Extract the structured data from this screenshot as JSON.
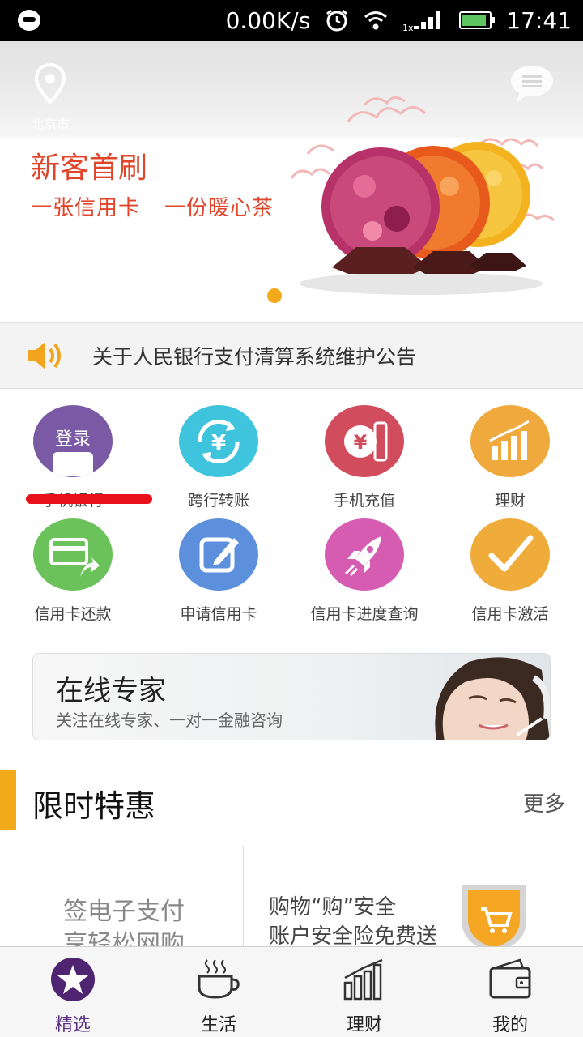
{
  "status_bar": {
    "network_speed": "0.00K/s",
    "time": "17:41",
    "signal_prefix": "1x"
  },
  "banner": {
    "location": "北京市",
    "promo_title": "新客首刷",
    "promo_sub_1": "一张信用卡",
    "promo_sub_2": "一份暖心茶"
  },
  "notice": {
    "text": "关于人民银行支付清算系统维护公告"
  },
  "services": {
    "row1": [
      {
        "label": "手机银行",
        "icon": "login-phone-icon",
        "inner_text": "登录"
      },
      {
        "label": "跨行转账",
        "icon": "transfer-icon"
      },
      {
        "label": "手机充值",
        "icon": "phone-recharge-icon"
      },
      {
        "label": "理财",
        "icon": "finance-chart-icon"
      }
    ],
    "row2": [
      {
        "label": "信用卡还款",
        "icon": "card-repay-icon"
      },
      {
        "label": "申请信用卡",
        "icon": "apply-card-icon"
      },
      {
        "label": "信用卡进度查询",
        "icon": "rocket-icon"
      },
      {
        "label": "信用卡激活",
        "icon": "checkmark-icon"
      }
    ]
  },
  "expert": {
    "title": "在线专家",
    "subtitle": "关注在线专家、一对一金融咨询"
  },
  "limited": {
    "title": "限时特惠",
    "more": "更多",
    "offer_left_1": "签电子支付",
    "offer_left_2": "享轻松网购",
    "offer_right_1": "购物“购”安全",
    "offer_right_2": "账户安全险免费送"
  },
  "bottom_nav": [
    {
      "label": "精选",
      "active": true
    },
    {
      "label": "生活",
      "active": false
    },
    {
      "label": "理财",
      "active": false
    },
    {
      "label": "我的",
      "active": false
    }
  ],
  "colors": {
    "accent": "#5a2d80",
    "promo": "#e0452a",
    "highlight": "#f2aa1a"
  }
}
